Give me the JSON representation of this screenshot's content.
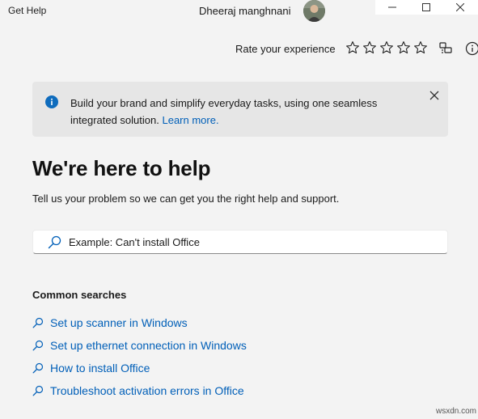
{
  "app": {
    "title": "Get Help"
  },
  "user": {
    "name": "Dheeraj manghnani"
  },
  "rating": {
    "label": "Rate your experience",
    "stars": 5
  },
  "banner": {
    "text": "Build your brand and simplify everyday tasks, using one seamless integrated solution.",
    "link": "Learn more."
  },
  "main": {
    "title": "We're here to help",
    "subtitle": "Tell us your problem so we can get you the right help and support."
  },
  "search": {
    "placeholder": "Example: Can't install Office"
  },
  "common_searches": {
    "heading": "Common searches",
    "items": [
      {
        "label": "Set up scanner in Windows"
      },
      {
        "label": "Set up ethernet connection in Windows"
      },
      {
        "label": "How to install Office"
      },
      {
        "label": "Troubleshoot activation errors in Office"
      }
    ]
  },
  "watermark": "wsxdn.com",
  "colors": {
    "link": "#005fb8",
    "info_icon": "#0f6cbd",
    "background": "#f3f3f3",
    "banner": "#e6e6e6"
  }
}
